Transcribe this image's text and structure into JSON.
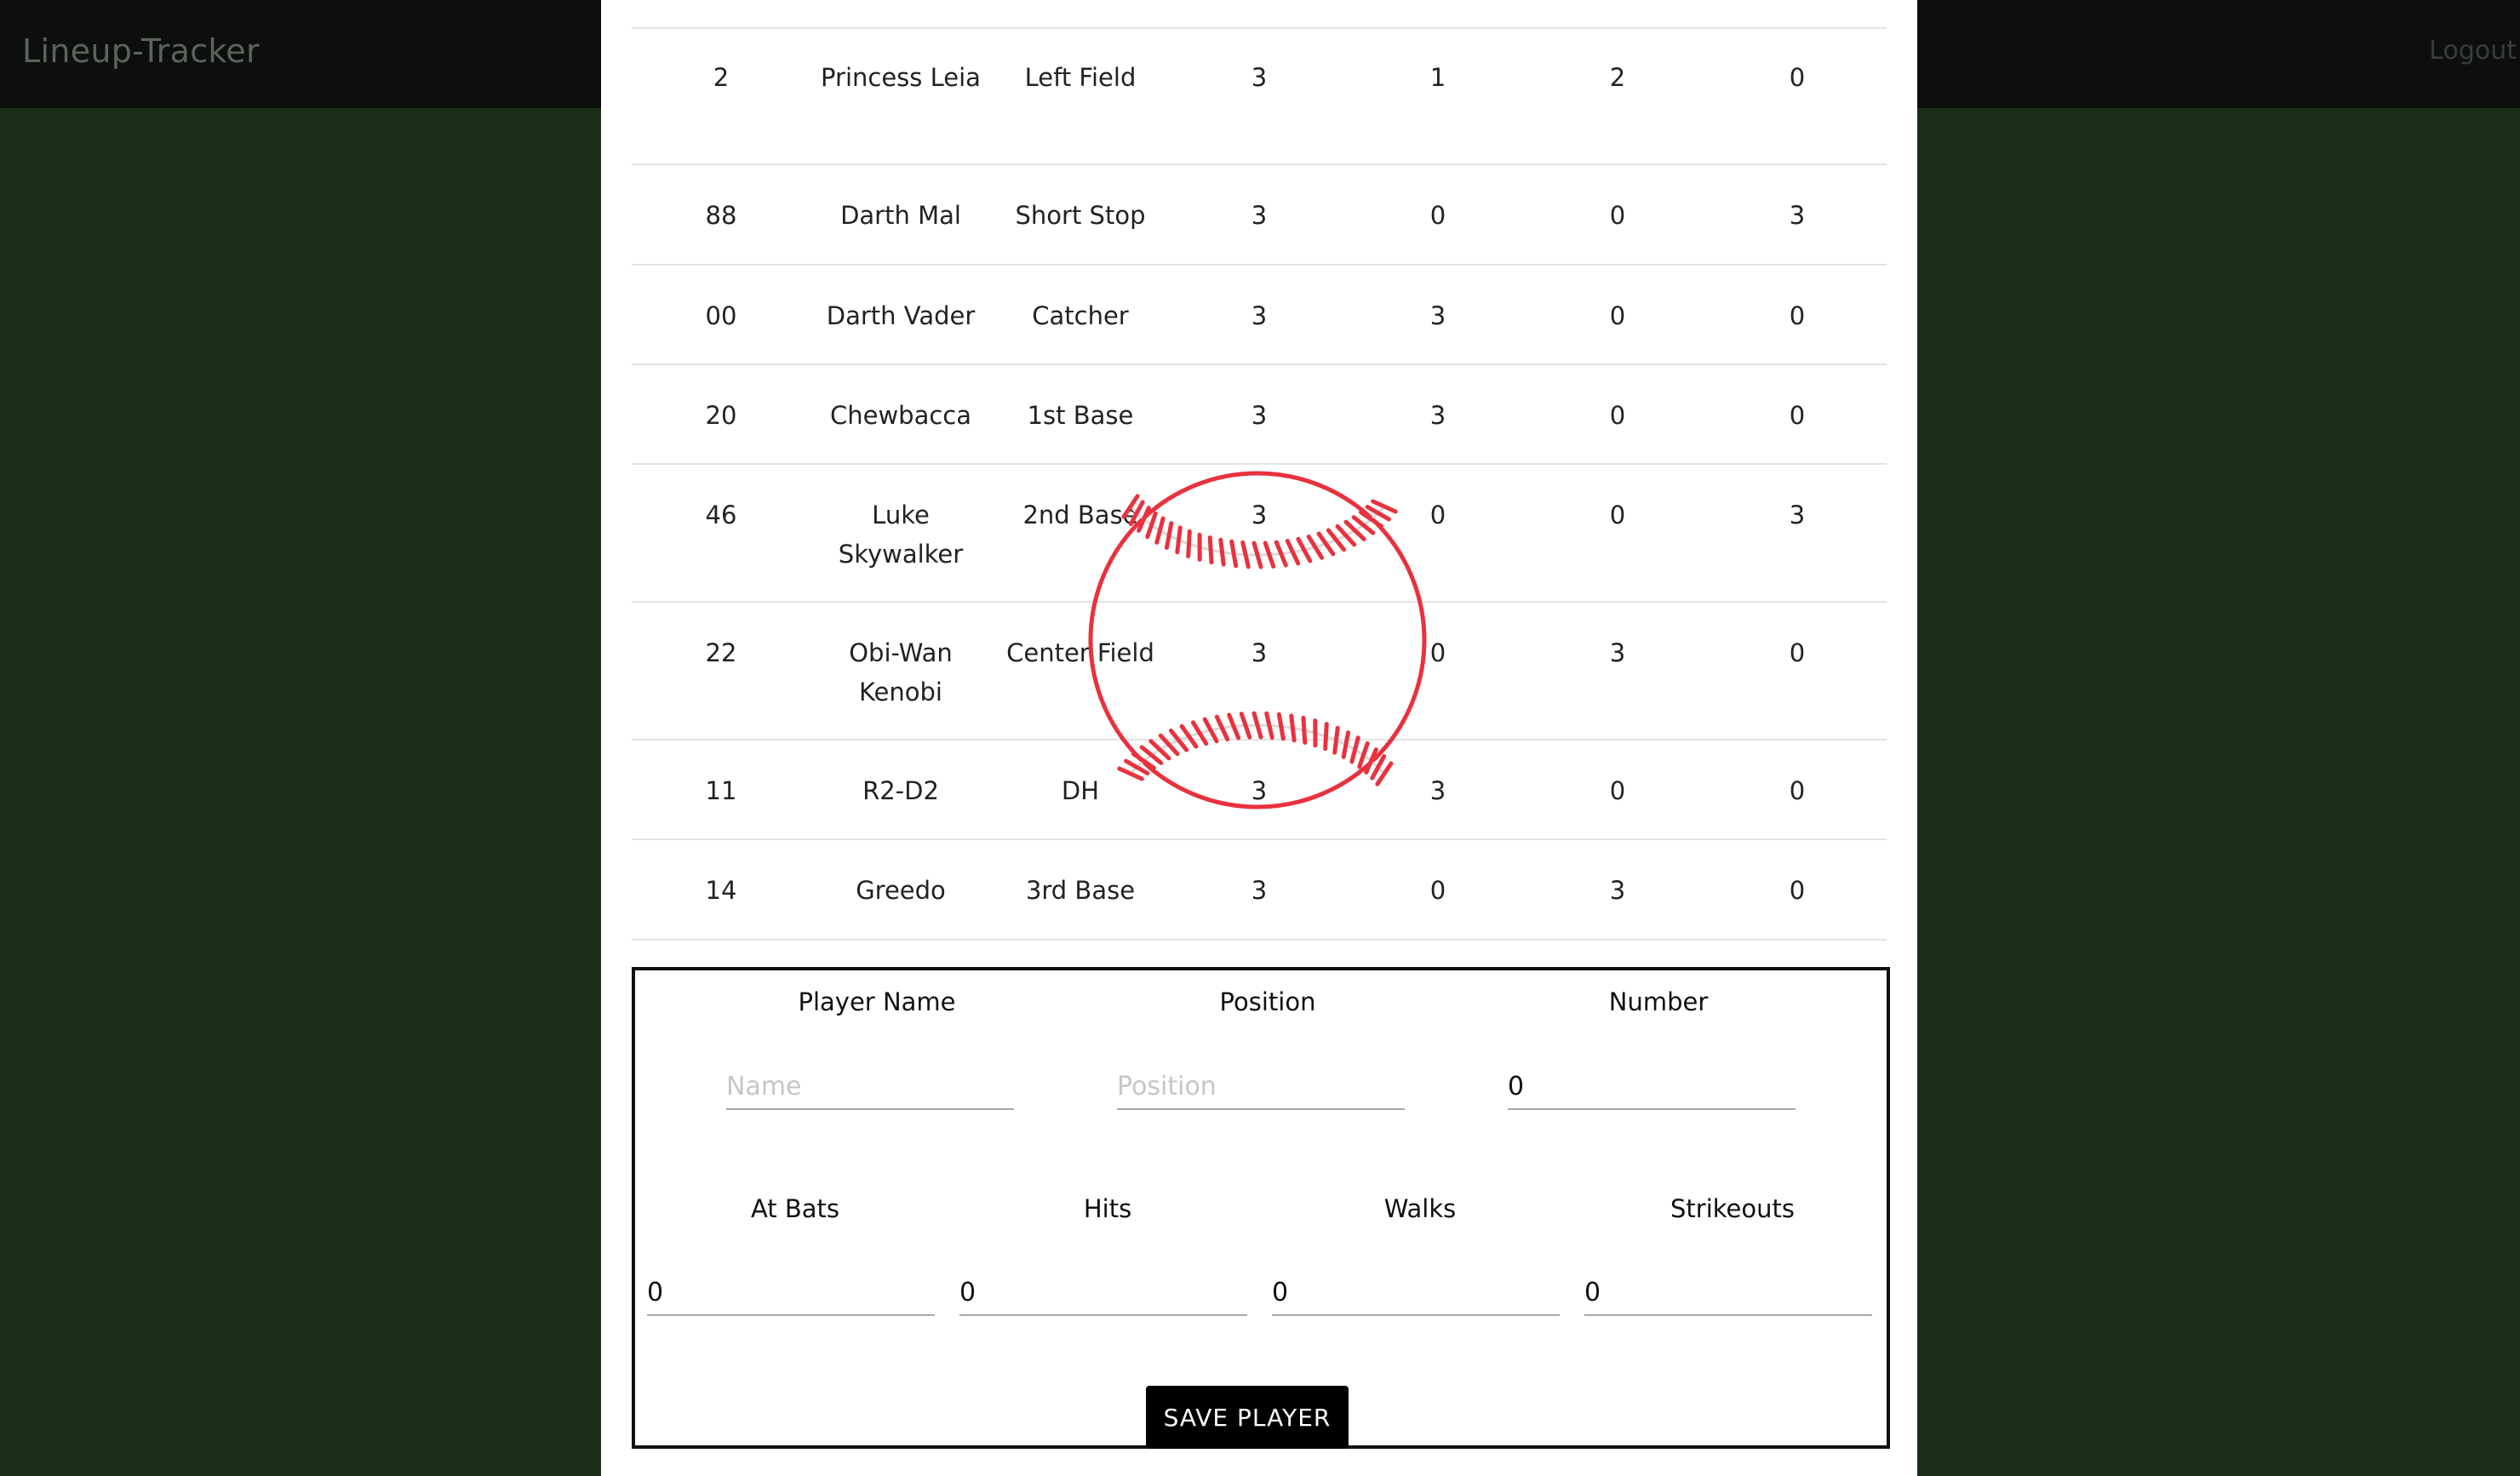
{
  "app": {
    "brand": "Lineup-Tracker",
    "logout_label": "Logout"
  },
  "roster": {
    "rows": [
      {
        "number": "2",
        "name": "Princess Leia",
        "position": "Left Field",
        "at_bats": "3",
        "hits": "1",
        "walks": "2",
        "strikeouts": "0"
      },
      {
        "number": "88",
        "name": "Darth Mal",
        "position": "Short Stop",
        "at_bats": "3",
        "hits": "0",
        "walks": "0",
        "strikeouts": "3"
      },
      {
        "number": "00",
        "name": "Darth Vader",
        "position": "Catcher",
        "at_bats": "3",
        "hits": "3",
        "walks": "0",
        "strikeouts": "0"
      },
      {
        "number": "20",
        "name": "Chewbacca",
        "position": "1st Base",
        "at_bats": "3",
        "hits": "3",
        "walks": "0",
        "strikeouts": "0"
      },
      {
        "number": "46",
        "name": "Luke Skywalker",
        "position": "2nd Base",
        "at_bats": "3",
        "hits": "0",
        "walks": "0",
        "strikeouts": "3"
      },
      {
        "number": "22",
        "name": "Obi-Wan Kenobi",
        "position": "Center Field",
        "at_bats": "3",
        "hits": "0",
        "walks": "3",
        "strikeouts": "0"
      },
      {
        "number": "11",
        "name": "R2-D2",
        "position": "DH",
        "at_bats": "3",
        "hits": "3",
        "walks": "0",
        "strikeouts": "0"
      },
      {
        "number": "14",
        "name": "Greedo",
        "position": "3rd Base",
        "at_bats": "3",
        "hits": "0",
        "walks": "3",
        "strikeouts": "0"
      }
    ]
  },
  "overlay": {
    "icon": "baseball-icon",
    "stitch_color": "#e8323e"
  },
  "form": {
    "player_name_label": "Player Name",
    "player_name_placeholder": "Name",
    "player_name_value": "",
    "position_label": "Position",
    "position_placeholder": "Position",
    "position_value": "",
    "number_label": "Number",
    "number_value": "0",
    "at_bats_label": "At Bats",
    "at_bats_value": "0",
    "hits_label": "Hits",
    "hits_value": "0",
    "walks_label": "Walks",
    "walks_value": "0",
    "strikeouts_label": "Strikeouts",
    "strikeouts_value": "0",
    "save_label": "SAVE PLAYER"
  }
}
